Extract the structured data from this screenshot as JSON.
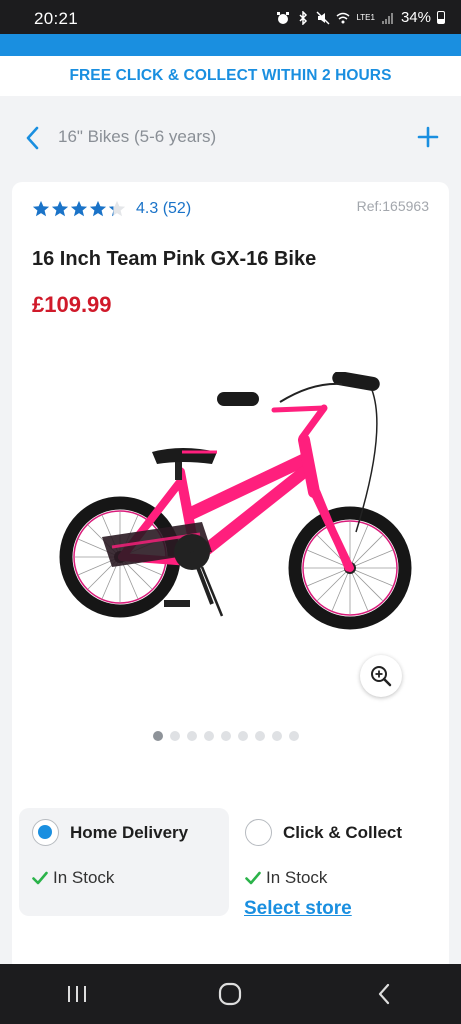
{
  "status_bar": {
    "time": "20:21",
    "network_label": "LTE1",
    "battery": "34%"
  },
  "promo": {
    "text": "FREE CLICK & COLLECT WITHIN 2 HOURS"
  },
  "nav": {
    "breadcrumb": "16\" Bikes (5-6 years)"
  },
  "product": {
    "rating_value": 4.3,
    "rating_text": "4.3 (52)",
    "review_count": 52,
    "ref": "Ref:165963",
    "title": "16 Inch Team Pink GX-16 Bike",
    "price": "£109.99",
    "image_alt": "Pink children's bike with black tyres",
    "gallery_count": 9,
    "gallery_active": 0
  },
  "delivery": {
    "options": [
      {
        "label": "Home Delivery",
        "stock": "In Stock",
        "selected": true
      },
      {
        "label": "Click & Collect",
        "stock": "In Stock",
        "selected": false,
        "link": "Select store"
      }
    ]
  },
  "colors": {
    "accent": "#1a8fe0",
    "price": "#d01a2a",
    "stock_check": "#2bb34a",
    "star": "#1a73c8"
  }
}
